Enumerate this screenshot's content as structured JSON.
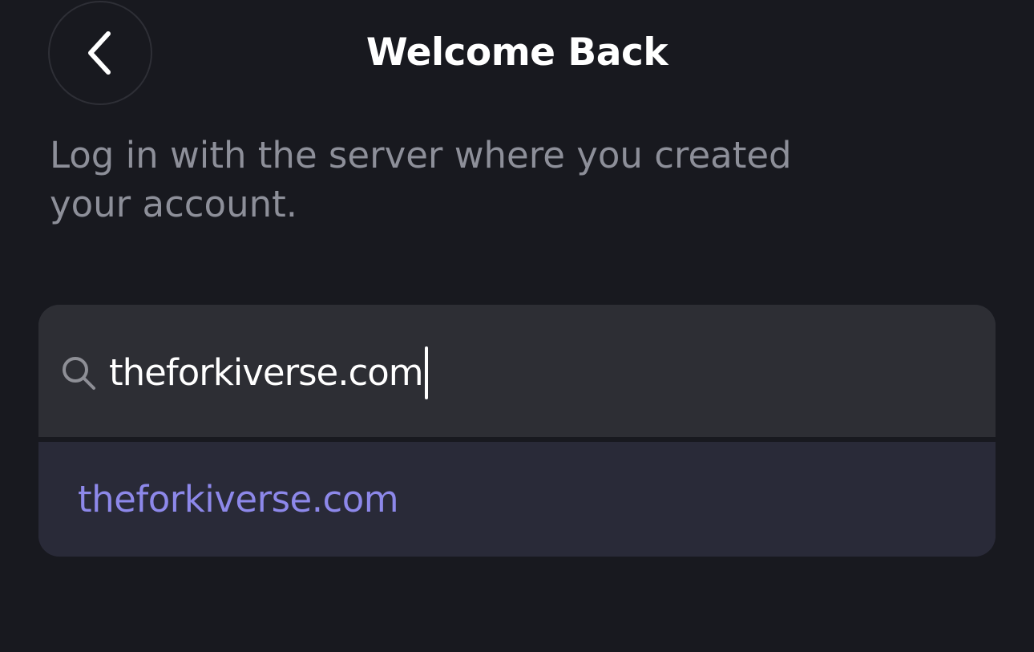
{
  "header": {
    "title": "Welcome Back",
    "back_icon": "chevron-left-icon"
  },
  "intro": {
    "text": "Log in with the server where you created your account."
  },
  "search": {
    "icon": "search-icon",
    "value": "theforkiverse.com",
    "caret_visible": true
  },
  "suggestions": [
    {
      "label": "theforkiverse.com"
    }
  ],
  "colors": {
    "background": "#18191f",
    "field": "#2d2e34",
    "suggestion_bg": "#292a38",
    "accent": "#8d88ea",
    "secondary_text": "#8d8f99"
  }
}
